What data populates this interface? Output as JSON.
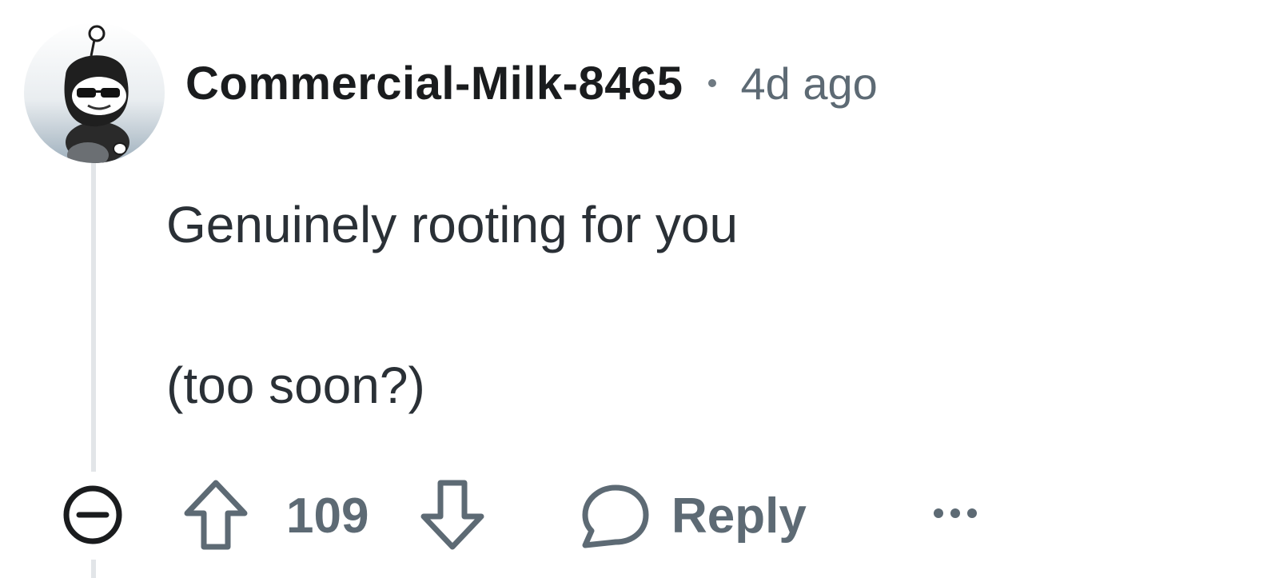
{
  "comment": {
    "author": "Commercial-Milk-8465",
    "time_ago": "4d ago",
    "body_lines": [
      "Genuinely rooting for you",
      "(too soon?)"
    ],
    "score": "109",
    "reply_label": "Reply"
  },
  "icons": {
    "avatar": "snoo-avatar",
    "collapse": "minus-circle-icon",
    "upvote": "arrow-up-icon",
    "downvote": "arrow-down-icon",
    "reply": "speech-bubble-icon",
    "more": "ellipsis-icon"
  },
  "colors": {
    "username": "#1a1c1e",
    "meta": "#5d6a74",
    "body": "#2a3036",
    "thread_line": "#e2e5e8"
  }
}
